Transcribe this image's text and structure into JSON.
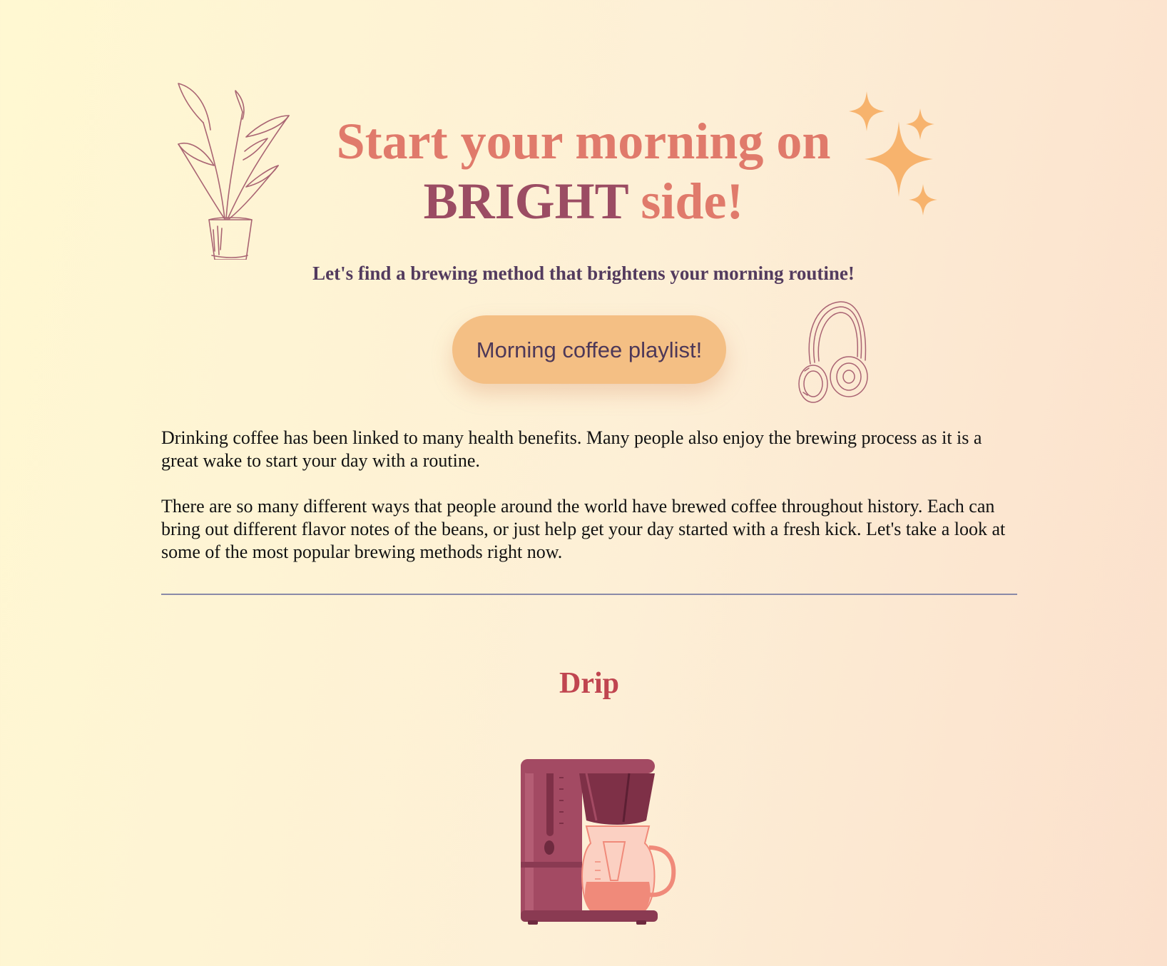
{
  "hero": {
    "title_part1": "Start your morning on",
    "title_bright": "BRIGHT",
    "title_part2": "side!",
    "subtitle": "Let's find a brewing method that brightens your morning routine!",
    "playlist_button": "Morning coffee playlist!"
  },
  "intro": {
    "paragraphs": [
      "Drinking coffee has been linked to many health benefits. Many people also enjoy the brewing process as it is a great wake to start your day with a routine.",
      "There are so many different ways that people around the world have brewed coffee throughout history. Each can bring out different flavor notes of the beans, or just help get your day started with a fresh kick. Let's take a look at some of the most popular brewing methods right now."
    ]
  },
  "sections": [
    {
      "title": "Drip",
      "icon": "coffee-maker-icon"
    }
  ],
  "icons": {
    "plant": "plant-icon",
    "sparkles": "sparkles-icon",
    "headphones": "headphones-icon"
  },
  "colors": {
    "title": "#e07a6b",
    "bright": "#9b4c63",
    "subtitle": "#533b5e",
    "button_bg": "#f4bf84",
    "section_title": "#c04550",
    "sparkle": "#f7b36d",
    "maker": "#a34a63",
    "carafe": "#f08a7a"
  }
}
